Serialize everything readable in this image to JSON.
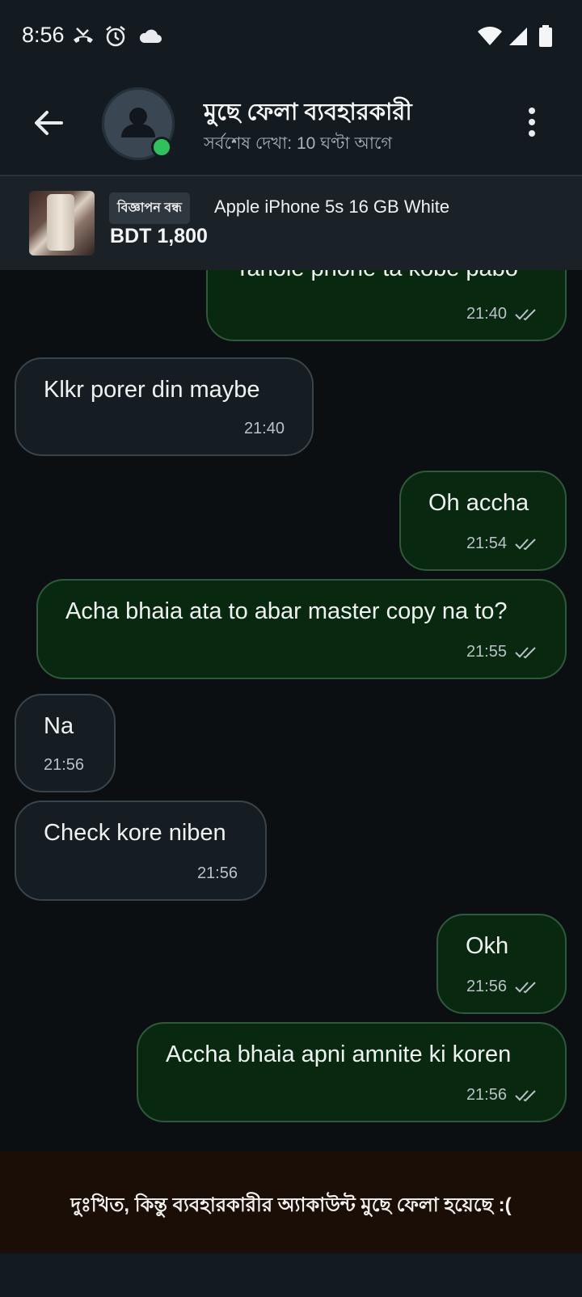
{
  "status_bar": {
    "time": "8:56",
    "icons": [
      "missed-call-icon",
      "alarm-icon",
      "cloud-icon",
      "wifi-icon",
      "signal-icon",
      "battery-icon"
    ]
  },
  "header": {
    "back_icon": "arrow-left-icon",
    "name": "মুছে ফেলা ব্যবহারকারী",
    "last_seen": "সর্বশেষ দেখা: 10 ঘণ্টা আগে",
    "online": true,
    "menu_icon": "more-vert-icon"
  },
  "ad": {
    "badge": "বিজ্ঞাপন বন্ধ",
    "title": "Apple iPhone 5s 16 GB White",
    "price": "BDT 1,800"
  },
  "messages": [
    {
      "dir": "out",
      "text": "Tahole phone ta kobe pabo",
      "time": "21:40",
      "read": true
    },
    {
      "dir": "in",
      "text": "Klkr porer din maybe",
      "time": "21:40"
    },
    {
      "dir": "out",
      "text": "Oh accha",
      "time": "21:54",
      "read": true
    },
    {
      "dir": "out",
      "text": "Acha bhaia ata to abar master copy na to?",
      "time": "21:55",
      "read": true
    },
    {
      "dir": "in",
      "text": "Na",
      "time": "21:56"
    },
    {
      "dir": "in",
      "text": "Check kore niben",
      "time": "21:56"
    },
    {
      "dir": "out",
      "text": "Okh",
      "time": "21:56",
      "read": true
    },
    {
      "dir": "out",
      "text": "Accha bhaia apni amnite ki koren",
      "time": "21:56",
      "read": true
    }
  ],
  "footer": {
    "notice": "দুঃখিত, কিন্তু ব্যবহারকারীর অ্যাকাউন্ট মুছে ফেলা হয়েছে :("
  },
  "colors": {
    "outgoing_bubble": "#08290f",
    "incoming_bubble": "#161d22",
    "online_dot": "#2fc15b",
    "footer_bg": "#1b0e06"
  }
}
